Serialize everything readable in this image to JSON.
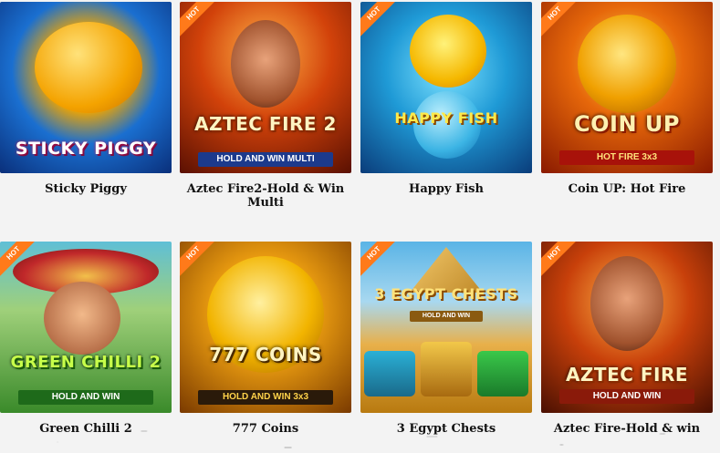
{
  "games": [
    {
      "title": "Sticky Piggy",
      "hot": "",
      "art_text": "STICKY PIGGY",
      "art_sub": ""
    },
    {
      "title": "Aztec Fire2-Hold & Win Multi",
      "hot": "HOT",
      "art_text": "AZTEC FIRE 2",
      "art_sub": "HOLD AND WIN MULTI"
    },
    {
      "title": "Happy Fish",
      "hot": "HOT",
      "art_text": "HAPPY FISH",
      "art_sub": ""
    },
    {
      "title": "Coin UP: Hot Fire",
      "hot": "HOT",
      "art_text": "COIN UP",
      "art_sub": "HOT FIRE 3x3"
    },
    {
      "title": "Green Chilli 2",
      "hot": "HOT",
      "art_text": "GREEN CHILLI 2",
      "art_sub": "HOLD AND WIN"
    },
    {
      "title": "777 Coins",
      "hot": "HOT",
      "art_text": "777 COINS",
      "art_sub": "HOLD AND WIN 3x3"
    },
    {
      "title": "3 Egypt Chests",
      "hot": "HOT",
      "art_text": "3 EGYPT CHESTS",
      "art_sub": "HOLD AND WIN"
    },
    {
      "title": "Aztec Fire-Hold & win",
      "hot": "HOT",
      "art_text": "AZTEC FIRE",
      "art_sub": "HOLD AND WIN"
    }
  ],
  "colors": {
    "hot_badge": "#ff7a1a",
    "title_text": "#111111",
    "background": "#f3f3f3"
  }
}
